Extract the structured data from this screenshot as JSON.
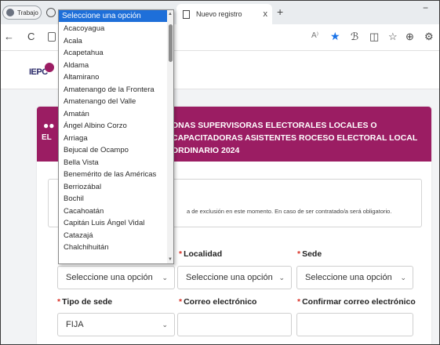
{
  "browser": {
    "profile_label": "Trabajo",
    "active_tab_title": "Nuevo registro",
    "new_tab_symbol": "+",
    "close_symbol": "x",
    "minimize_symbol": "−",
    "back_symbol": "←",
    "refresh_symbol": "C",
    "read_aloud_symbol": "A⁾",
    "star_symbol": "★",
    "toolbar_icons": [
      "ℬ",
      "◫",
      "☆",
      "⊕",
      "⚙"
    ]
  },
  "site": {
    "logo_text": "IEPC"
  },
  "banner": {
    "left_text": "EL",
    "title": "ONAS SUPERVISORAS ELECTORALES LOCALES O CAPACITADORAS ASISTENTES ROCESO ELECTORAL LOCAL ORDINARIO 2024"
  },
  "info": {
    "text": "a de exclusión en este momento. En caso de ser contratado/a será obligatorio."
  },
  "form": {
    "required_mark": "*",
    "municipio_value": "Seleccione una opción",
    "localidad_label": "Localidad",
    "localidad_value": "Seleccione una opción",
    "sede_label": "Sede",
    "sede_value": "Seleccione una opción",
    "tipo_sede_label": "Tipo de sede",
    "tipo_sede_value": "FIJA",
    "correo_label": "Correo electrónico",
    "confirmar_correo_label": "Confirmar correo electrónico"
  },
  "dropdown": {
    "selected": "Seleccione una opción",
    "options": [
      "Acacoyagua",
      "Acala",
      "Acapetahua",
      "Aldama",
      "Altamirano",
      "Amatenango de la Frontera",
      "Amatenango del Valle",
      "Amatán",
      "Ángel Albino Corzo",
      "Arriaga",
      "Bejucal de Ocampo",
      "Bella Vista",
      "Benemérito de las Américas",
      "Berriozábal",
      "Bochil",
      "Cacahoatán",
      "Capitán Luis Ángel Vidal",
      "Catazajá",
      "Chalchihuitán"
    ]
  },
  "colors": {
    "brand": "#9b1d63",
    "dropdown_highlight": "#1e6fd9",
    "required": "#d93025"
  }
}
